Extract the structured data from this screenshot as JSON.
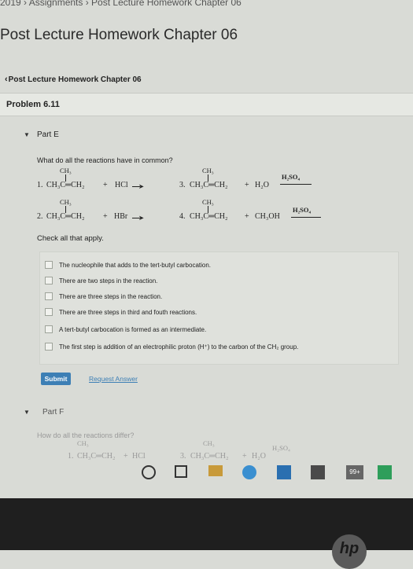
{
  "breadcrumb": "2019 › Assignments › Post Lecture Homework Chapter 06",
  "page_title": "Post Lecture Homework Chapter 06",
  "back_link": "Post Lecture Homework Chapter 06",
  "problem_label": "Problem 6.11",
  "partE": {
    "label": "Part E",
    "question": "What do all the reactions have in common?",
    "reactions": {
      "r1": {
        "methyl": "CH3",
        "main": "1. CH3C=CH2 + HCl",
        "num": "1.",
        "formula": "CH₃C═CH₂",
        "plus": "+",
        "reagent": "HCl"
      },
      "r2": {
        "methyl": "CH3",
        "num": "2.",
        "formula": "CH₃C═CH₂",
        "plus": "+",
        "reagent": "HBr"
      },
      "r3": {
        "methyl": "CH3",
        "num": "3.",
        "formula": "CH₃C═CH₂",
        "plus": "+",
        "reagent": "H₂O",
        "catalyst": "H₂SO₄"
      },
      "r4": {
        "methyl": "CH3",
        "num": "4.",
        "formula": "CH₃C═CH₂",
        "plus": "+",
        "reagent": "CH₃OH",
        "catalyst": "H₂SO₄"
      }
    },
    "methyl_display": "CH₃",
    "check_all": "Check all that apply.",
    "options": [
      "The nucleophile that adds to the tert-butyl carbocation.",
      "There are two steps in the reaction.",
      "There are three steps in the reaction.",
      "There are three steps in third and fouth reactions.",
      "A tert-butyl carbocation is formed as an intermediate.",
      "The first step is addition of an electrophilic proton (H⁺) to the carbon of the CH₂ group."
    ],
    "submit": "Submit",
    "request_answer": "Request Answer"
  },
  "partF": {
    "label": "Part F",
    "question": "How do all the reactions differ?",
    "r1": {
      "num": "1.",
      "formula": "CH₃C═CH₂",
      "plus": "+",
      "reagent": "HCl"
    },
    "r3": {
      "num": "3.",
      "formula": "CH₃C═CH₂",
      "plus": "+",
      "reagent": "H₂O",
      "catalyst": "H₂SO₄"
    },
    "methyl_display": "CH₃"
  },
  "taskbar": {
    "badge": "99+"
  },
  "bezel_logo": "hp"
}
